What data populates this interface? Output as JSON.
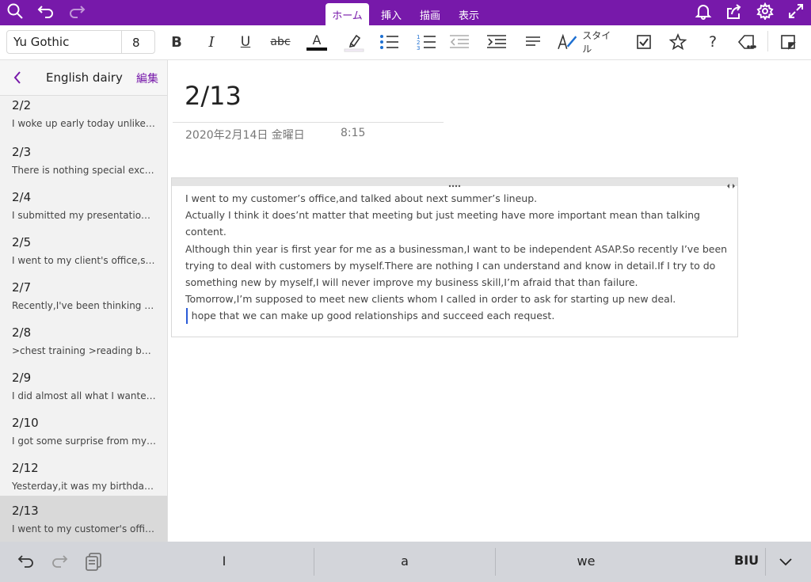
{
  "app": {
    "tabs": [
      "ホーム",
      "挿入",
      "描画",
      "表示"
    ],
    "active_tab": "ホーム",
    "accent_color": "#7719aa"
  },
  "ribbon": {
    "font_name": "Yu Gothic",
    "font_size": "8",
    "bold_label": "B",
    "italic_label": "I",
    "underline_label": "U",
    "strike_label": "abc",
    "font_color_label": "A",
    "style_label": "スタイル",
    "help_label": "?"
  },
  "sidebar": {
    "title": "English dairy",
    "edit_label": "編集",
    "pages": [
      {
        "title": "2/2",
        "preview": "I woke up early today unlike y..."
      },
      {
        "title": "2/3",
        "preview": "There is nothing special exce..."
      },
      {
        "title": "2/4",
        "preview": "I submitted my presentation..."
      },
      {
        "title": "2/5",
        "preview": "I  went to my client's office,so..."
      },
      {
        "title": "2/7",
        "preview": "Recently,I've been thinking ab..."
      },
      {
        "title": "2/8",
        "preview": ">chest training  >reading boo..."
      },
      {
        "title": "2/9",
        "preview": "I did almost all what I wanted..."
      },
      {
        "title": "2/10",
        "preview": "I got some surprise from my g..."
      },
      {
        "title": "2/12",
        "preview": "Yesterday,it was my birthday...."
      },
      {
        "title": "2/13",
        "preview": "I went to my customer's offic..."
      }
    ],
    "selected_index": 9
  },
  "page": {
    "title": "2/13",
    "date": "2020年2月14日 金曜日",
    "time": "8:15",
    "lines": [
      "I went to my customer’s office,and talked about next summer’s lineup.",
      "Actually I think it does’nt matter that meeting but just meeting have more important mean than talking content.",
      "Although thin year is first year for me as a businessman,I want to be independent ASAP.So recently I’ve been trying to deal with customers by myself.There are nothing I can understand and know in detail.If I try to do something new by myself,I will never improve my business skill,I’m afraid that than failure.",
      "Tomorrow,I’m supposed to meet new clients whom I called in order to ask for starting up new deal.",
      "I hope that we can make up good relationships and succeed each request."
    ]
  },
  "keyboard": {
    "suggestions": [
      "I",
      "a",
      "we"
    ],
    "format_label": "BIU"
  }
}
